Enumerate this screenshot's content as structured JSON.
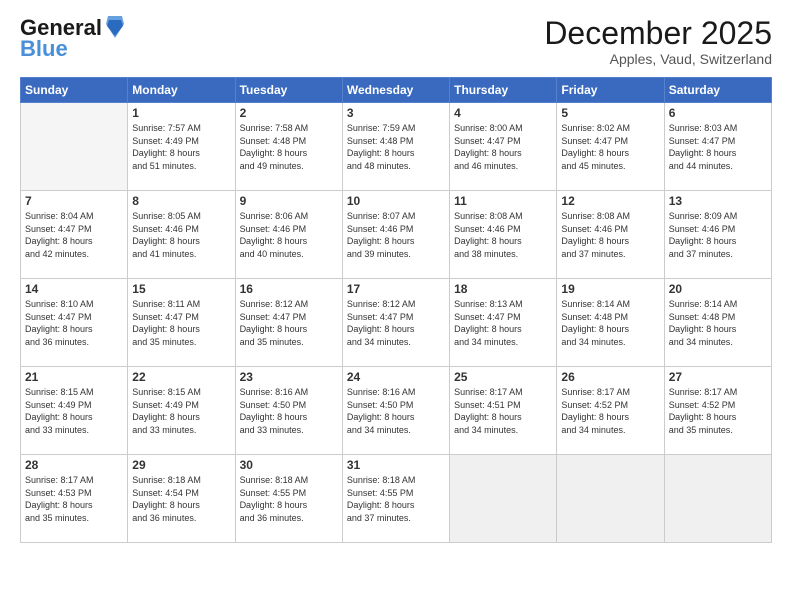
{
  "logo": {
    "line1": "General",
    "line2": "Blue"
  },
  "title": "December 2025",
  "location": "Apples, Vaud, Switzerland",
  "weekdays": [
    "Sunday",
    "Monday",
    "Tuesday",
    "Wednesday",
    "Thursday",
    "Friday",
    "Saturday"
  ],
  "weeks": [
    [
      {
        "day": "",
        "info": ""
      },
      {
        "day": "1",
        "info": "Sunrise: 7:57 AM\nSunset: 4:49 PM\nDaylight: 8 hours\nand 51 minutes."
      },
      {
        "day": "2",
        "info": "Sunrise: 7:58 AM\nSunset: 4:48 PM\nDaylight: 8 hours\nand 49 minutes."
      },
      {
        "day": "3",
        "info": "Sunrise: 7:59 AM\nSunset: 4:48 PM\nDaylight: 8 hours\nand 48 minutes."
      },
      {
        "day": "4",
        "info": "Sunrise: 8:00 AM\nSunset: 4:47 PM\nDaylight: 8 hours\nand 46 minutes."
      },
      {
        "day": "5",
        "info": "Sunrise: 8:02 AM\nSunset: 4:47 PM\nDaylight: 8 hours\nand 45 minutes."
      },
      {
        "day": "6",
        "info": "Sunrise: 8:03 AM\nSunset: 4:47 PM\nDaylight: 8 hours\nand 44 minutes."
      }
    ],
    [
      {
        "day": "7",
        "info": "Sunrise: 8:04 AM\nSunset: 4:47 PM\nDaylight: 8 hours\nand 42 minutes."
      },
      {
        "day": "8",
        "info": "Sunrise: 8:05 AM\nSunset: 4:46 PM\nDaylight: 8 hours\nand 41 minutes."
      },
      {
        "day": "9",
        "info": "Sunrise: 8:06 AM\nSunset: 4:46 PM\nDaylight: 8 hours\nand 40 minutes."
      },
      {
        "day": "10",
        "info": "Sunrise: 8:07 AM\nSunset: 4:46 PM\nDaylight: 8 hours\nand 39 minutes."
      },
      {
        "day": "11",
        "info": "Sunrise: 8:08 AM\nSunset: 4:46 PM\nDaylight: 8 hours\nand 38 minutes."
      },
      {
        "day": "12",
        "info": "Sunrise: 8:08 AM\nSunset: 4:46 PM\nDaylight: 8 hours\nand 37 minutes."
      },
      {
        "day": "13",
        "info": "Sunrise: 8:09 AM\nSunset: 4:46 PM\nDaylight: 8 hours\nand 37 minutes."
      }
    ],
    [
      {
        "day": "14",
        "info": "Sunrise: 8:10 AM\nSunset: 4:47 PM\nDaylight: 8 hours\nand 36 minutes."
      },
      {
        "day": "15",
        "info": "Sunrise: 8:11 AM\nSunset: 4:47 PM\nDaylight: 8 hours\nand 35 minutes."
      },
      {
        "day": "16",
        "info": "Sunrise: 8:12 AM\nSunset: 4:47 PM\nDaylight: 8 hours\nand 35 minutes."
      },
      {
        "day": "17",
        "info": "Sunrise: 8:12 AM\nSunset: 4:47 PM\nDaylight: 8 hours\nand 34 minutes."
      },
      {
        "day": "18",
        "info": "Sunrise: 8:13 AM\nSunset: 4:47 PM\nDaylight: 8 hours\nand 34 minutes."
      },
      {
        "day": "19",
        "info": "Sunrise: 8:14 AM\nSunset: 4:48 PM\nDaylight: 8 hours\nand 34 minutes."
      },
      {
        "day": "20",
        "info": "Sunrise: 8:14 AM\nSunset: 4:48 PM\nDaylight: 8 hours\nand 34 minutes."
      }
    ],
    [
      {
        "day": "21",
        "info": "Sunrise: 8:15 AM\nSunset: 4:49 PM\nDaylight: 8 hours\nand 33 minutes."
      },
      {
        "day": "22",
        "info": "Sunrise: 8:15 AM\nSunset: 4:49 PM\nDaylight: 8 hours\nand 33 minutes."
      },
      {
        "day": "23",
        "info": "Sunrise: 8:16 AM\nSunset: 4:50 PM\nDaylight: 8 hours\nand 33 minutes."
      },
      {
        "day": "24",
        "info": "Sunrise: 8:16 AM\nSunset: 4:50 PM\nDaylight: 8 hours\nand 34 minutes."
      },
      {
        "day": "25",
        "info": "Sunrise: 8:17 AM\nSunset: 4:51 PM\nDaylight: 8 hours\nand 34 minutes."
      },
      {
        "day": "26",
        "info": "Sunrise: 8:17 AM\nSunset: 4:52 PM\nDaylight: 8 hours\nand 34 minutes."
      },
      {
        "day": "27",
        "info": "Sunrise: 8:17 AM\nSunset: 4:52 PM\nDaylight: 8 hours\nand 35 minutes."
      }
    ],
    [
      {
        "day": "28",
        "info": "Sunrise: 8:17 AM\nSunset: 4:53 PM\nDaylight: 8 hours\nand 35 minutes."
      },
      {
        "day": "29",
        "info": "Sunrise: 8:18 AM\nSunset: 4:54 PM\nDaylight: 8 hours\nand 36 minutes."
      },
      {
        "day": "30",
        "info": "Sunrise: 8:18 AM\nSunset: 4:55 PM\nDaylight: 8 hours\nand 36 minutes."
      },
      {
        "day": "31",
        "info": "Sunrise: 8:18 AM\nSunset: 4:55 PM\nDaylight: 8 hours\nand 37 minutes."
      },
      {
        "day": "",
        "info": ""
      },
      {
        "day": "",
        "info": ""
      },
      {
        "day": "",
        "info": ""
      }
    ]
  ]
}
